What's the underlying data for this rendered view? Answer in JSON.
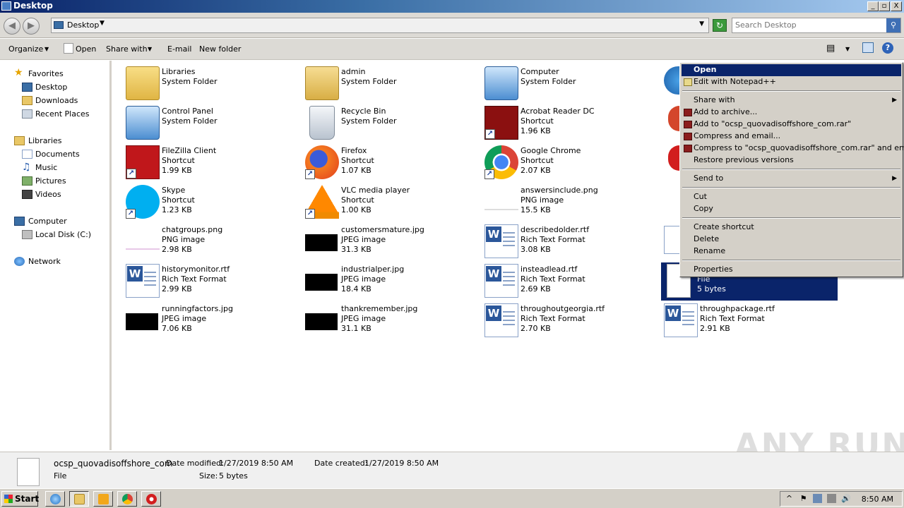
{
  "window": {
    "title": "Desktop",
    "buttons": [
      "_",
      "▫",
      "X"
    ]
  },
  "address": {
    "location": "Desktop",
    "search_placeholder": "Search Desktop"
  },
  "toolbar": {
    "organize": "Organize",
    "open": "Open",
    "share_with": "Share with",
    "email": "E-mail",
    "new_folder": "New folder"
  },
  "sidebar": {
    "favorites": {
      "label": "Favorites",
      "items": [
        "Desktop",
        "Downloads",
        "Recent Places"
      ]
    },
    "libraries": {
      "label": "Libraries",
      "items": [
        "Documents",
        "Music",
        "Pictures",
        "Videos"
      ]
    },
    "computer": {
      "label": "Computer",
      "items": [
        "Local Disk (C:)"
      ]
    },
    "network": {
      "label": "Network"
    }
  },
  "files": [
    {
      "name": "Libraries",
      "type": "System Folder",
      "size": ""
    },
    {
      "name": "admin",
      "type": "System Folder",
      "size": ""
    },
    {
      "name": "Computer",
      "type": "System Folder",
      "size": ""
    },
    {
      "name": "Control Panel",
      "type": "System Folder",
      "size": ""
    },
    {
      "name": "Recycle Bin",
      "type": "System Folder",
      "size": ""
    },
    {
      "name": "Acrobat Reader DC",
      "type": "Shortcut",
      "size": "1.96 KB"
    },
    {
      "name": "FileZilla Client",
      "type": "Shortcut",
      "size": "1.99 KB"
    },
    {
      "name": "Firefox",
      "type": "Shortcut",
      "size": "1.07 KB"
    },
    {
      "name": "Google Chrome",
      "type": "Shortcut",
      "size": "2.07 KB"
    },
    {
      "name": "Skype",
      "type": "Shortcut",
      "size": "1.23 KB"
    },
    {
      "name": "VLC media player",
      "type": "Shortcut",
      "size": "1.00 KB"
    },
    {
      "name": "answersinclude.png",
      "type": "PNG image",
      "size": "15.5 KB"
    },
    {
      "name": "chatgroups.png",
      "type": "PNG image",
      "size": "2.98 KB"
    },
    {
      "name": "customersmature.jpg",
      "type": "JPEG image",
      "size": "31.3 KB"
    },
    {
      "name": "describedolder.rtf",
      "type": "Rich Text Format",
      "size": "3.08 KB"
    },
    {
      "name": "historymonitor.rtf",
      "type": "Rich Text Format",
      "size": "2.99 KB"
    },
    {
      "name": "industrialper.jpg",
      "type": "JPEG image",
      "size": "18.4 KB"
    },
    {
      "name": "insteadlead.rtf",
      "type": "Rich Text Format",
      "size": "2.69 KB"
    },
    {
      "name": "",
      "type": "File",
      "size": "5 bytes"
    },
    {
      "name": "runningfactors.jpg",
      "type": "JPEG image",
      "size": "7.06 KB"
    },
    {
      "name": "thankremember.jpg",
      "type": "JPEG image",
      "size": "31.1 KB"
    },
    {
      "name": "throughoutgeorgia.rtf",
      "type": "Rich Text Format",
      "size": "2.70 KB"
    },
    {
      "name": "throughpackage.rtf",
      "type": "Rich Text Format",
      "size": "2.91 KB"
    }
  ],
  "context_menu": {
    "open": "Open",
    "edit_notepad": "Edit with Notepad++",
    "share_with": "Share with",
    "add_archive": "Add to archive...",
    "add_rar": "Add to \"ocsp_quovadisoffshore_com.rar\"",
    "compress_email": "Compress and email...",
    "compress_rar_email": "Compress to \"ocsp_quovadisoffshore_com.rar\" and email",
    "restore": "Restore previous versions",
    "send_to": "Send to",
    "cut": "Cut",
    "copy": "Copy",
    "create_shortcut": "Create shortcut",
    "delete": "Delete",
    "rename": "Rename",
    "properties": "Properties"
  },
  "details": {
    "name": "ocsp_quovadisoffshore_com",
    "type": "File",
    "modified_label": "Date modified:",
    "modified": "1/27/2019 8:50 AM",
    "created_label": "Date created:",
    "created": "1/27/2019 8:50 AM",
    "size_label": "Size:",
    "size": "5 bytes"
  },
  "watermark": "ANY RUN",
  "taskbar": {
    "start": "Start",
    "clock": "8:50 AM"
  }
}
